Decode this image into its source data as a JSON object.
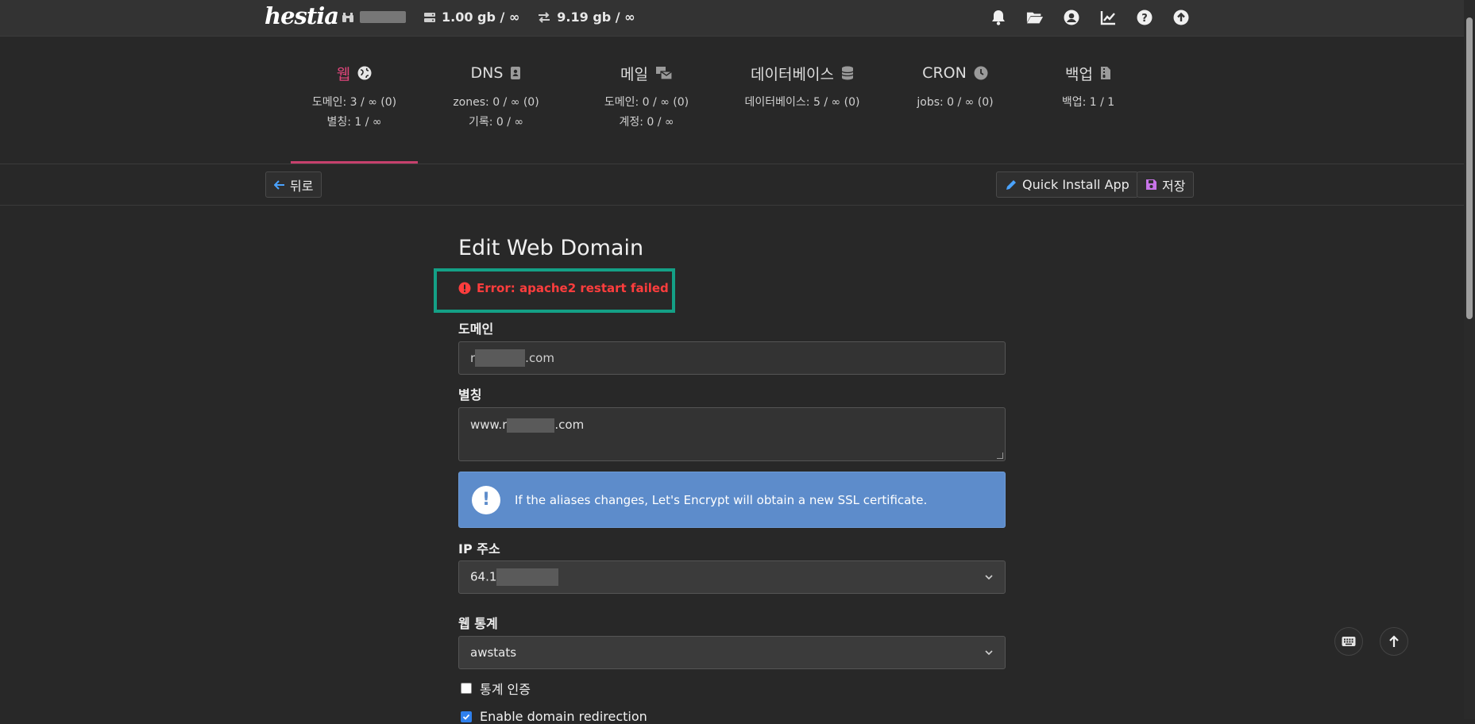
{
  "app": {
    "logo": "hestia"
  },
  "topbar": {
    "disk_value": "1.00 gb / ∞",
    "bandwidth_value": "9.19 gb / ∞"
  },
  "tabs": [
    {
      "label": "웹",
      "stat1": "도메인: 3 / ∞ (0)",
      "stat2": "별칭: 1 / ∞",
      "active": true
    },
    {
      "label": "DNS",
      "stat1": "zones: 0 / ∞ (0)",
      "stat2": "기록: 0 / ∞"
    },
    {
      "label": "메일",
      "stat1": "도메인: 0 / ∞ (0)",
      "stat2": "계정: 0 / ∞"
    },
    {
      "label": "데이터베이스",
      "stat1": "데이터베이스: 5 / ∞ (0)"
    },
    {
      "label": "CRON",
      "stat1": "jobs: 0 / ∞ (0)"
    },
    {
      "label": "백업",
      "stat1": "백업: 1 / 1"
    }
  ],
  "toolbar": {
    "back_label": "뒤로",
    "quick_install_label": "Quick Install App",
    "save_label": "저장"
  },
  "form": {
    "title": "Edit Web Domain",
    "error": "Error: apache2 restart failed",
    "domain_label": "도메인",
    "domain_prefix": "r",
    "domain_suffix": ".com",
    "aliases_label": "별칭",
    "aliases_prefix": "www.r",
    "aliases_suffix": ".com",
    "alert_text": "If the aliases changes, Let's Encrypt will obtain a new SSL certificate.",
    "ip_label": "IP 주소",
    "ip_prefix": "64.1",
    "stats_label": "웹 통계",
    "stats_value": "awstats",
    "stats_auth_label": "통계 인증",
    "stats_auth_checked": false,
    "redirect_label": "Enable domain redirection",
    "redirect_checked": true
  },
  "colors": {
    "accent": "#c7406d",
    "error": "#ff3d3d",
    "highlight_box": "#14a086",
    "alert_bg": "#5d8ccb"
  }
}
